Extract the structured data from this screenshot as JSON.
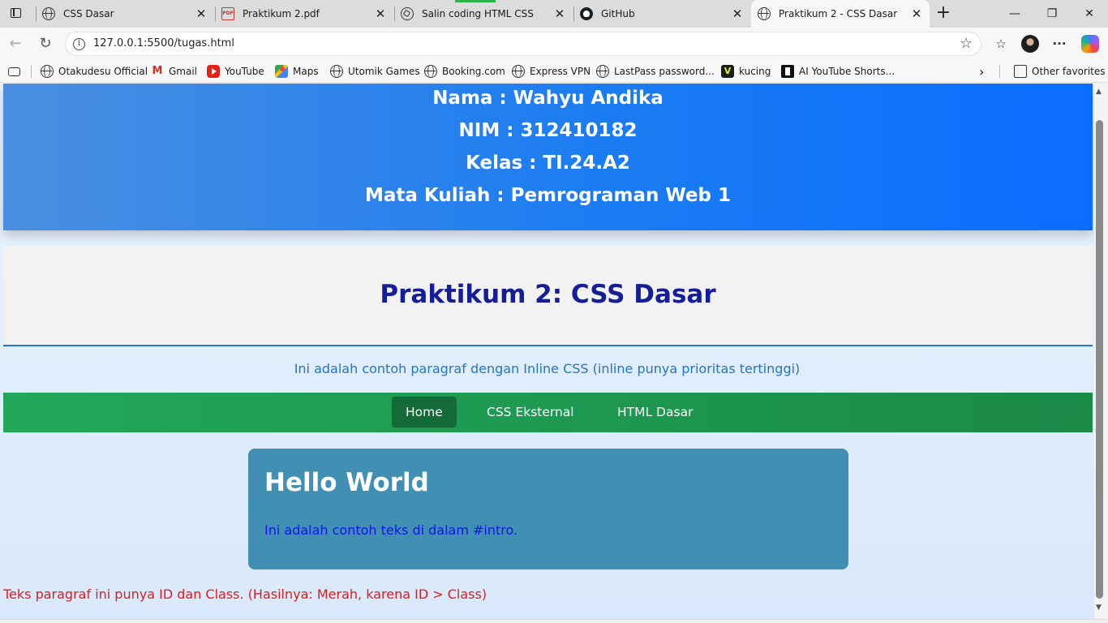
{
  "browser": {
    "tabs": [
      {
        "title": "CSS Dasar",
        "icon": "globe-icon",
        "active": false
      },
      {
        "title": "Praktikum 2.pdf",
        "icon": "pdf-icon",
        "active": false
      },
      {
        "title": "Salin coding HTML CSS",
        "icon": "chatgpt-icon",
        "active": false
      },
      {
        "title": "GitHub",
        "icon": "github-icon",
        "active": false
      },
      {
        "title": "Praktikum 2 - CSS Dasar",
        "icon": "globe-icon",
        "active": true
      }
    ],
    "address_bar": {
      "url": "127.0.0.1:5500/tugas.html"
    },
    "bookmarks": [
      {
        "label": "Otakudesu Official",
        "icon": "globe-icon"
      },
      {
        "label": "Gmail",
        "icon": "gmail-icon"
      },
      {
        "label": "YouTube",
        "icon": "youtube-icon"
      },
      {
        "label": "Maps",
        "icon": "maps-icon"
      },
      {
        "label": "Utomik Games",
        "icon": "globe-icon"
      },
      {
        "label": "Booking.com",
        "icon": "globe-icon"
      },
      {
        "label": "Express VPN",
        "icon": "globe-icon"
      },
      {
        "label": "LastPass password...",
        "icon": "globe-icon"
      },
      {
        "label": "kucing",
        "icon": "v-icon"
      },
      {
        "label": "AI YouTube Shorts...",
        "icon": "app-icon"
      }
    ],
    "other_favorites": "Other favorites"
  },
  "page": {
    "header": {
      "nama": "Nama : Wahyu Andika",
      "nim": "NIM : 312410182",
      "kelas": "Kelas : TI.24.A2",
      "matkul": "Mata Kuliah : Pemrograman Web 1"
    },
    "title": "Praktikum 2: CSS Dasar",
    "inline_paragraph": "Ini adalah contoh paragraf dengan Inline CSS (inline punya prioritas tertinggi)",
    "nav": [
      {
        "label": "Home",
        "active": true
      },
      {
        "label": "CSS Eksternal",
        "active": false
      },
      {
        "label": "HTML Dasar",
        "active": false
      }
    ],
    "intro": {
      "heading": "Hello World",
      "text": "Ini adalah contoh teks di dalam #intro."
    },
    "red_paragraph": "Teks paragraf ini punya ID dan Class. (Hasilnya: Merah, karena ID > Class)"
  },
  "colors": {
    "header_gradient": [
      "#4a8fe0",
      "#0a6dff"
    ],
    "title": "#151e96",
    "inline_paragraph": "#2275c9",
    "nav_bg": "#22a85a",
    "nav_active": "#156b38",
    "intro_bg": "#4190b3",
    "intro_text": "#0c17e6",
    "red_text": "#e11b1b"
  }
}
